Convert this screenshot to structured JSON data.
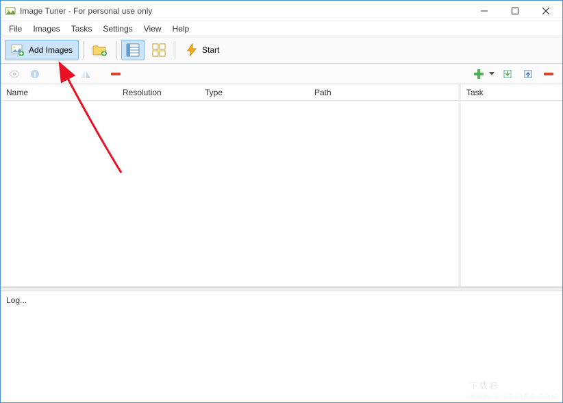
{
  "window": {
    "title": "Image Tuner - For personal use only"
  },
  "menu": {
    "file": "File",
    "images": "Images",
    "tasks": "Tasks",
    "settings": "Settings",
    "view": "View",
    "help": "Help"
  },
  "toolbar": {
    "add_images": "Add Images",
    "start": "Start"
  },
  "columns": {
    "name": "Name",
    "resolution": "Resolution",
    "type": "Type",
    "path": "Path",
    "task": "Task"
  },
  "log": {
    "label": "Log..."
  },
  "watermark": {
    "text": "下载吧",
    "url": "WWW.XIAZAIBA.COM"
  }
}
